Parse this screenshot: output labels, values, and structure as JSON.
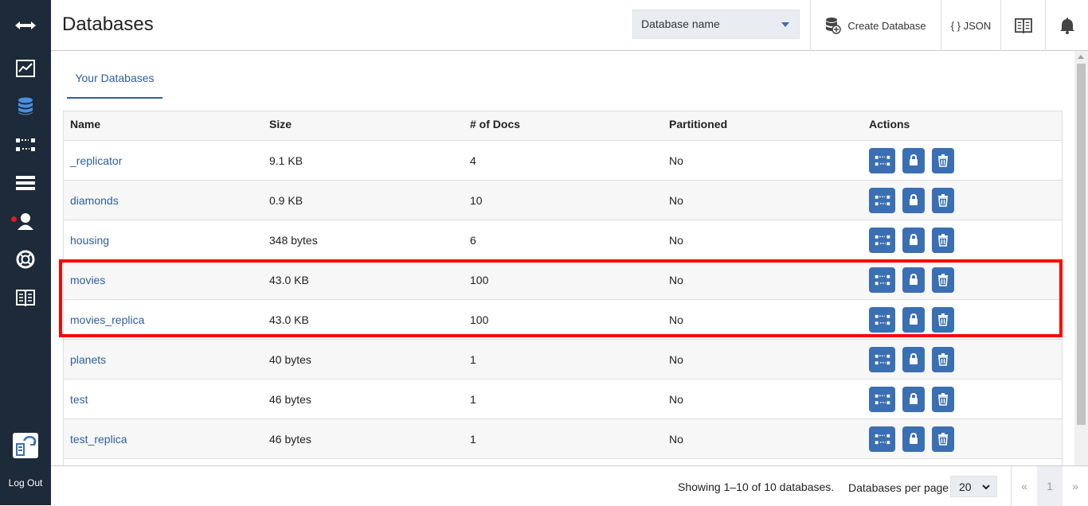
{
  "header": {
    "title": "Databases",
    "search_placeholder": "Database name",
    "create_label": "Create Database",
    "json_label": "{ } JSON"
  },
  "tabs": [
    {
      "label": "Your Databases"
    }
  ],
  "table": {
    "columns": [
      "Name",
      "Size",
      "# of Docs",
      "Partitioned",
      "Actions"
    ],
    "rows": [
      {
        "name": "_replicator",
        "size": "9.1 KB",
        "docs": "4",
        "partitioned": "No"
      },
      {
        "name": "diamonds",
        "size": "0.9 KB",
        "docs": "10",
        "partitioned": "No"
      },
      {
        "name": "housing",
        "size": "348 bytes",
        "docs": "6",
        "partitioned": "No"
      },
      {
        "name": "movies",
        "size": "43.0 KB",
        "docs": "100",
        "partitioned": "No"
      },
      {
        "name": "movies_replica",
        "size": "43.0 KB",
        "docs": "100",
        "partitioned": "No"
      },
      {
        "name": "planets",
        "size": "40 bytes",
        "docs": "1",
        "partitioned": "No"
      },
      {
        "name": "test",
        "size": "46 bytes",
        "docs": "1",
        "partitioned": "No"
      },
      {
        "name": "test_replica",
        "size": "46 bytes",
        "docs": "1",
        "partitioned": "No"
      }
    ]
  },
  "footer": {
    "showing": "Showing 1–10 of 10 databases.",
    "per_page_label": "Databases per page",
    "per_page_value": "20",
    "pager_prev": "«",
    "pager_current": "1",
    "pager_next": "»"
  },
  "sidebar": {
    "logout_label": "Log Out",
    "icons": [
      "expand-icon",
      "activity-chart-icon",
      "database-icon",
      "replication-icon",
      "server-icon",
      "user-icon",
      "support-icon",
      "documentation-icon",
      "couchdb-logo-icon"
    ]
  },
  "colors": {
    "sidebar_bg": "#1c2a39",
    "accent": "#3b6fb3",
    "highlight": "#ff0000",
    "active_nav": "#4a90e2"
  }
}
